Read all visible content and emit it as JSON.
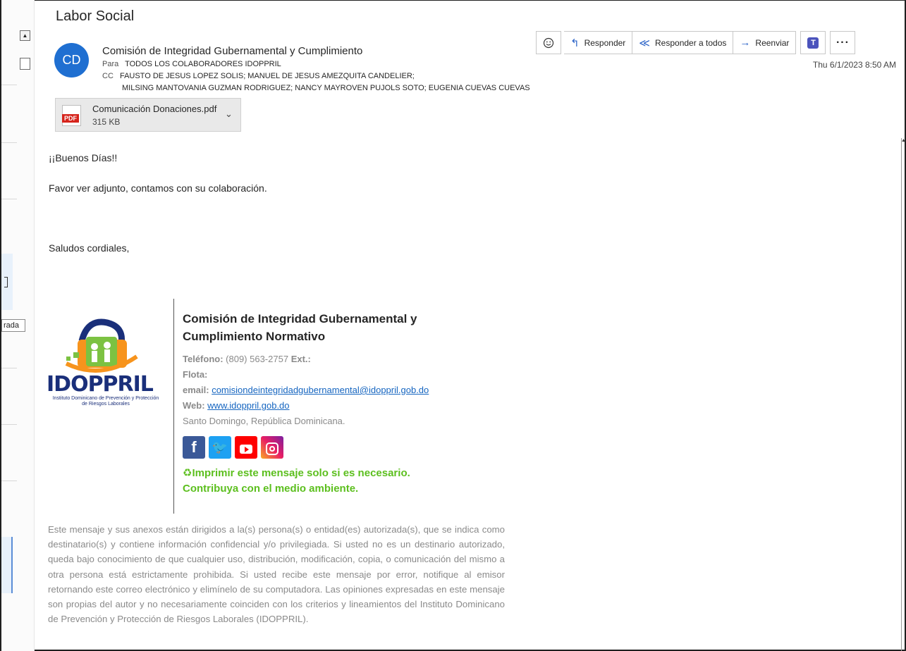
{
  "email": {
    "subject": "Labor Social",
    "avatar_initials": "CD",
    "sender": "Comisión de Integridad Gubernamental y Cumplimiento",
    "to_label": "Para",
    "to": "TODOS LOS COLABORADORES IDOPPRIL",
    "cc_label": "CC",
    "cc_line1": "FAUSTO DE JESUS LOPEZ SOLIS; MANUEL DE JESUS AMEZQUITA CANDELIER;",
    "cc_line2": "MILSING MANTOVANIA GUZMAN RODRIGUEZ; NANCY MAYROVEN PUJOLS SOTO; EUGENIA CUEVAS CUEVAS",
    "datetime": "Thu 6/1/2023 8:50 AM"
  },
  "toolbar": {
    "reply_label": "Responder",
    "reply_all_label": "Responder a todos",
    "forward_label": "Reenviar",
    "more_label": "···"
  },
  "attachment": {
    "badge": "PDF",
    "name": "Comunicación Donaciones.pdf",
    "size": "315 KB"
  },
  "left_pane": {
    "tab_fragment": "rada"
  },
  "body": {
    "greeting": "¡¡Buenos Días!!",
    "line1": "Favor ver adjunto, contamos con su colaboración.",
    "closing": "Saludos cordiales,"
  },
  "signature": {
    "title": "Comisión de Integridad Gubernamental y Cumplimiento Normativo",
    "phone_label": "Teléfono:",
    "phone": "(809) 563-2757",
    "ext_label": "Ext.:",
    "flota_label": "Flota:",
    "email_label": "email:",
    "email": "comisiondeintegridadgubernamental@idoppril.gob.do",
    "web_label": "Web:",
    "web": "www.idoppril.gob.do",
    "location": "Santo Domingo, República Dominicana.",
    "logo_text": "IDOPPRIL",
    "logo_sub": "Instituto Dominicano de Prevención y Protección de Riesgos Laborales",
    "print_notice": "Imprimir este mensaje solo si es necesario.",
    "env_notice": "Contribuya con el medio ambiente."
  },
  "disclaimer": "Este mensaje y sus anexos están dirigidos a la(s) persona(s) o entidad(es) autorizada(s), que se indica como destinatario(s) y contiene información confidencial y/o privilegiada. Si usted no es un destinario autorizado, queda bajo conocimiento de que cualquier uso, distribución, modificación, copia, o comunicación del mismo a otra persona está estrictamente prohibida. Si usted recibe este mensaje por error, notifique al emisor retornando este correo electrónico y elimínelo de su computadora. Las opiniones expresadas en este mensaje son propias del autor y no necesariamente coinciden con los criterios y lineamientos del Instituto Dominicano de Prevención y Protección de Riesgos Laborales (IDOPPRIL).",
  "colors": {
    "accent": "#1f6fd1",
    "link": "#1565c0",
    "green": "#5cbf1e",
    "logo_navy": "#1a2f7a"
  }
}
